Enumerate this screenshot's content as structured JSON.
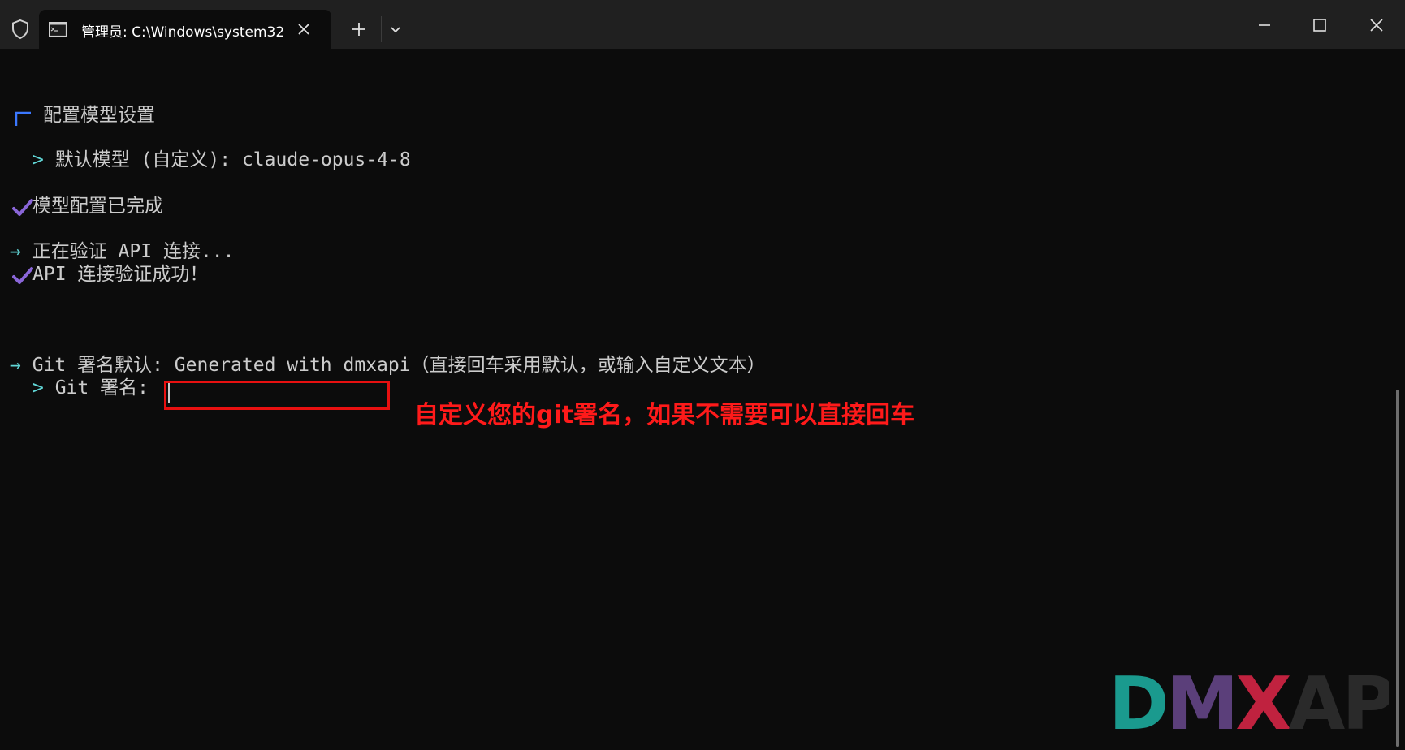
{
  "window": {
    "tab_title": "管理员: C:\\Windows\\system32",
    "new_tab_label": "+"
  },
  "terminal": {
    "section_title": "配置模型设置",
    "default_model_prompt": "默认模型 (自定义): ",
    "default_model_value": "claude-opus-4-8",
    "model_config_done": "模型配置已完成",
    "verifying_api": "正在验证 API 连接...",
    "api_success": "API 连接验证成功！",
    "git_signature_default_label": "Git 署名默认: ",
    "git_signature_default_value": "Generated with dmxapi",
    "git_signature_hint": "（直接回车采用默认，或输入自定义文本）",
    "git_signature_prompt": "Git 署名: ",
    "git_signature_input": ""
  },
  "annotation": {
    "text": "自定义您的git署名，如果不需要可以直接回车",
    "color": "#e81010"
  },
  "logo": {
    "text": "DMXAPI",
    "colors": {
      "D": "#1a9a8e",
      "M": "#5b3f7a",
      "X": "#c0223f",
      "API": "#2a2a2a"
    }
  },
  "colors": {
    "background": "#0c0c0c",
    "titlebar": "#202020",
    "text": "#cccccc",
    "accent_cyan": "#61d6d6",
    "check_purple": "#8a66d8",
    "bracket_blue": "#3b78ff"
  }
}
